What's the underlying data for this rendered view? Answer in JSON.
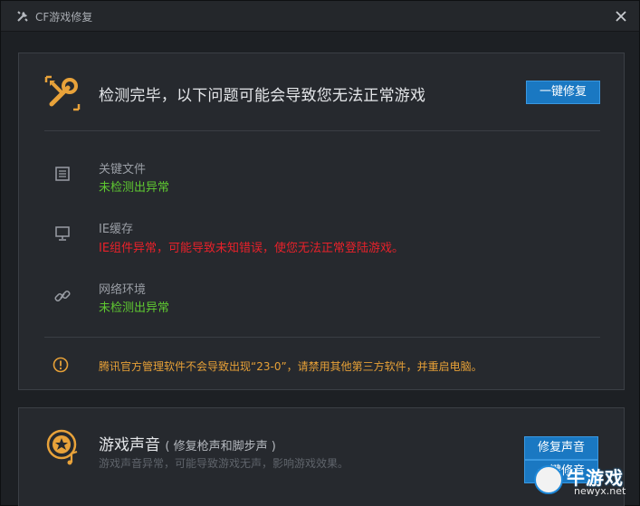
{
  "window": {
    "title": "CF游戏修复"
  },
  "scan": {
    "title": "检测完毕，以下问题可能会导致您无法正常游戏",
    "fix_all_label": "一键修复",
    "items": [
      {
        "name": "关键文件",
        "status": "未检测出异常",
        "state": "ok",
        "icon": "file-icon"
      },
      {
        "name": "IE缓存",
        "status": "IE组件异常，可能导致未知错误，使您无法正常登陆游戏。",
        "state": "error",
        "icon": "monitor-icon"
      },
      {
        "name": "网络环境",
        "status": "未检测出异常",
        "state": "ok",
        "icon": "link-icon"
      }
    ],
    "warning": "腾讯官方管理软件不会导致出现“23-0”，请禁用其他第三方软件，并重启电脑。"
  },
  "sound": {
    "title": "游戏声音",
    "subtitle": "( 修复枪声和脚步声 )",
    "desc": "游戏声音异常，可能导致游戏无声，影响游戏效果。",
    "fix_label": "修复声音",
    "fix_label_2": "一键修音"
  },
  "watermark": {
    "text": "牛游戏",
    "url": "newyx.net"
  },
  "colors": {
    "accent_blue": "#1a78c2",
    "ok_green": "#5fc831",
    "error_red": "#e8212a",
    "warning_orange": "#e6a037",
    "icon_orange": "#e8a23a"
  }
}
